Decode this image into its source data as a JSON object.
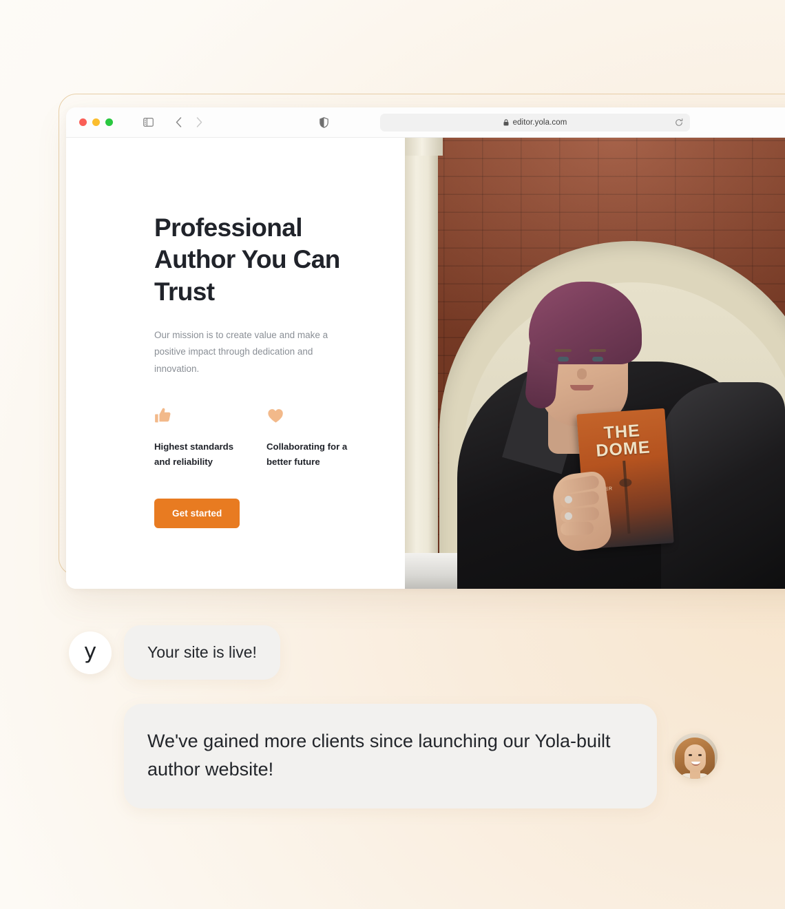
{
  "browser": {
    "url": "editor.yola.com",
    "traffic_lights": [
      "close-red",
      "minimize-yellow",
      "maximize-green"
    ],
    "icons": {
      "sidebar": "sidebar-toggle-icon",
      "back": "nav-back-icon",
      "forward": "nav-forward-icon",
      "shield": "shield-privacy-icon",
      "lock": "lock-icon",
      "reload": "reload-icon"
    }
  },
  "site": {
    "heading": "Professional Author You Can Trust",
    "subheading": "Our mission is to create value and make a positive impact through dedication and innovation.",
    "features": [
      {
        "icon": "thumbs-up-icon",
        "label": "Highest standards and reliability"
      },
      {
        "icon": "heart-icon",
        "label": "Collaborating for a better future"
      }
    ],
    "cta_label": "Get started",
    "hero_image": {
      "alt": "Author with purple hair in a black leather jacket holding her book",
      "book_title": "THE DOME",
      "book_author": "SUMMER"
    }
  },
  "chat": {
    "messages": [
      {
        "avatar": "yola-logo-avatar",
        "avatar_mark": "y",
        "text": "Your site is live!"
      },
      {
        "avatar": "user-photo-avatar",
        "text": "We've gained more clients since launching our Yola-built author website!"
      }
    ]
  },
  "colors": {
    "cta_orange": "#e87b21",
    "feature_icon_peach": "#f2b98a",
    "bubble_gray": "#f2f1ef",
    "frame_tan": "#e8cfa8",
    "background_cream": "#f6e6d0",
    "heading_dark": "#20232a",
    "body_gray": "#8a8f96"
  }
}
